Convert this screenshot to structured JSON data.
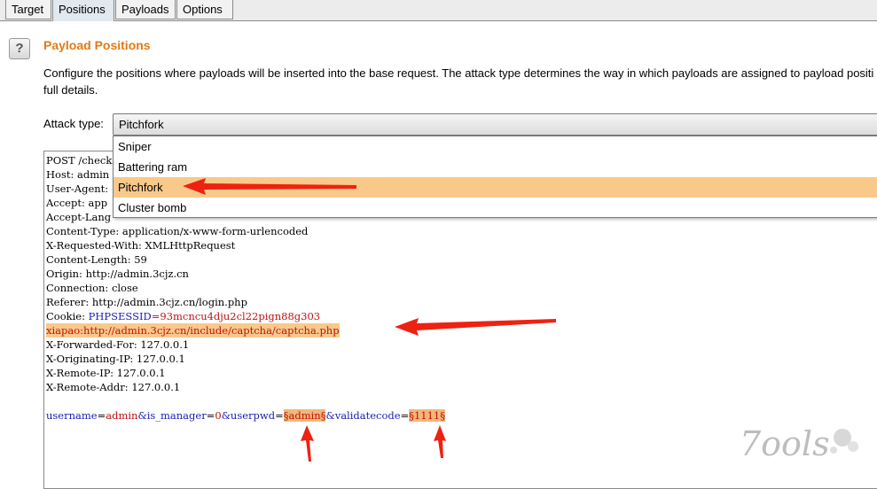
{
  "tabs": [
    "Target",
    "Positions",
    "Payloads",
    "Options"
  ],
  "section": {
    "title": "Payload Positions",
    "description_line1": "Configure the positions where payloads will be inserted into the base request. The attack type determines the way in which payloads are assigned to payload positi",
    "description_line2": "full details."
  },
  "attack": {
    "label": "Attack type:",
    "selected": "Pitchfork",
    "options": [
      "Sniper",
      "Battering ram",
      "Pitchfork",
      "Cluster bomb"
    ]
  },
  "request": {
    "line_post": "POST /check",
    "line_host": "Host: admin",
    "line_ua": "User-Agent:",
    "line_accept": "Accept: app",
    "line_acceptlang": "Accept-Lang",
    "line_ct": "Content-Type: application/x-www-form-urlencoded",
    "line_xrw": "X-Requested-With: XMLHttpRequest",
    "line_cl": "Content-Length: 59",
    "line_origin": "Origin: http://admin.3cjz.cn",
    "line_conn": "Connection: close",
    "line_referer": "Referer: http://admin.3cjz.cn/login.php",
    "cookie_key": "Cookie: ",
    "cookie_name": "PHPSESSID",
    "cookie_value": "=93mcncu4dju2cl22pign88g303",
    "xiapao_key": "xiapao",
    "xiapao_value": ":http://admin.3cjz.cn/include/captcha/captcha.php",
    "line_xff": "X-Forwarded-For: 127.0.0.1",
    "line_xoip": "X-Originating-IP: 127.0.0.1",
    "line_xrip": "X-Remote-IP: 127.0.0.1",
    "line_xraddr": "X-Remote-Addr: 127.0.0.1",
    "body_part1_key": "username",
    "body_part1_eq": "=",
    "body_part1_val": "admin",
    "body_part2_key": "&is_manager",
    "body_part2_eq": "=",
    "body_part2_val": "0",
    "body_part3_key": "&userpwd",
    "body_part3_eq": "=",
    "body_payload1": "§admin§",
    "body_part4_key": "&validatecode",
    "body_part4_eq": "=",
    "body_payload2": "§1111§"
  },
  "watermark_text": "7ools",
  "colors": {
    "title": "#e07b14",
    "highlight": "#f9c98a",
    "arrow": "#ee2211"
  }
}
